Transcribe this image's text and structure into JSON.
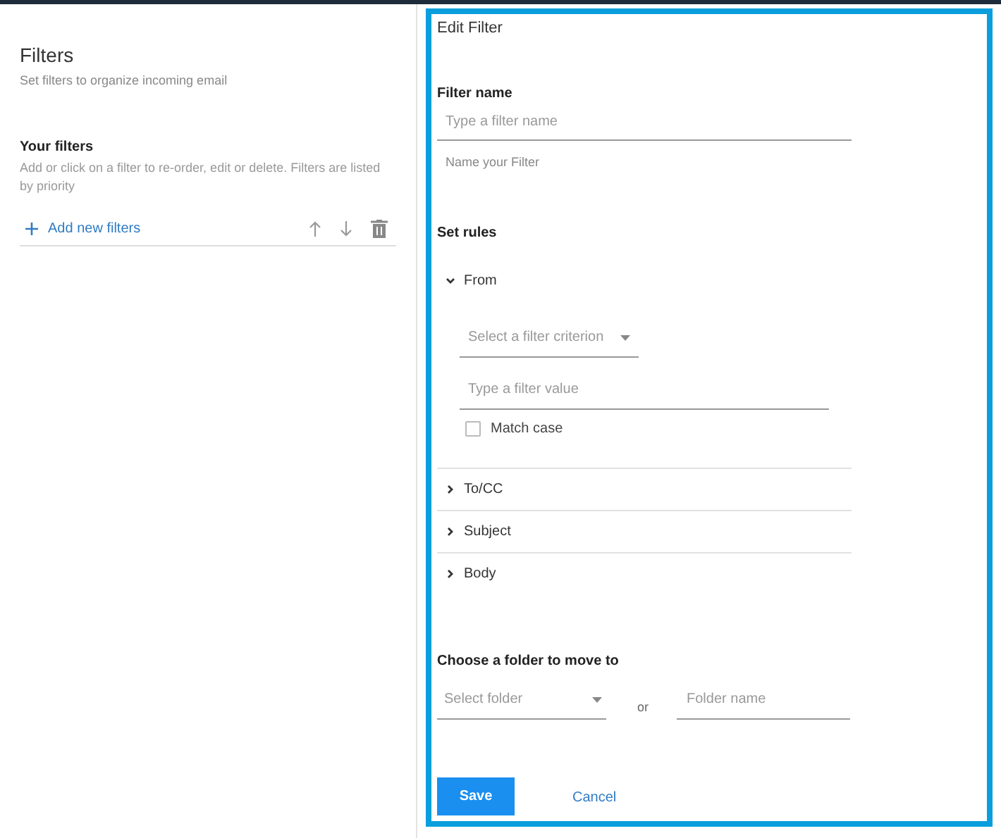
{
  "sidebar": {
    "title": "Filters",
    "subtitle": "Set filters to organize incoming email",
    "section_title": "Your filters",
    "section_description": "Add or click on a filter to re-order, edit or delete. Filters are listed by priority",
    "add_link": "Add new filters"
  },
  "editor": {
    "title": "Edit Filter",
    "filter_name_label": "Filter name",
    "filter_name": {
      "placeholder": "Type a filter name"
    },
    "filter_name_hint": "Name your Filter",
    "rules_label": "Set rules",
    "rules": [
      {
        "label": "From",
        "expanded": true,
        "criterion": {
          "placeholder": "Select a filter criterion"
        },
        "value": {
          "placeholder": "Type a filter value"
        },
        "match_case": {
          "label": "Match case",
          "checked": false
        }
      },
      {
        "label": "To/CC",
        "expanded": false
      },
      {
        "label": "Subject",
        "expanded": false
      },
      {
        "label": "Body",
        "expanded": false
      }
    ],
    "folder_label": "Choose a folder to move to",
    "folder_select": {
      "placeholder": "Select folder"
    },
    "or": "or",
    "folder_name": {
      "placeholder": "Folder name"
    },
    "buttons": [
      {
        "label": "Save",
        "kind": "primary"
      },
      {
        "label": "Cancel",
        "kind": "link"
      }
    ]
  }
}
